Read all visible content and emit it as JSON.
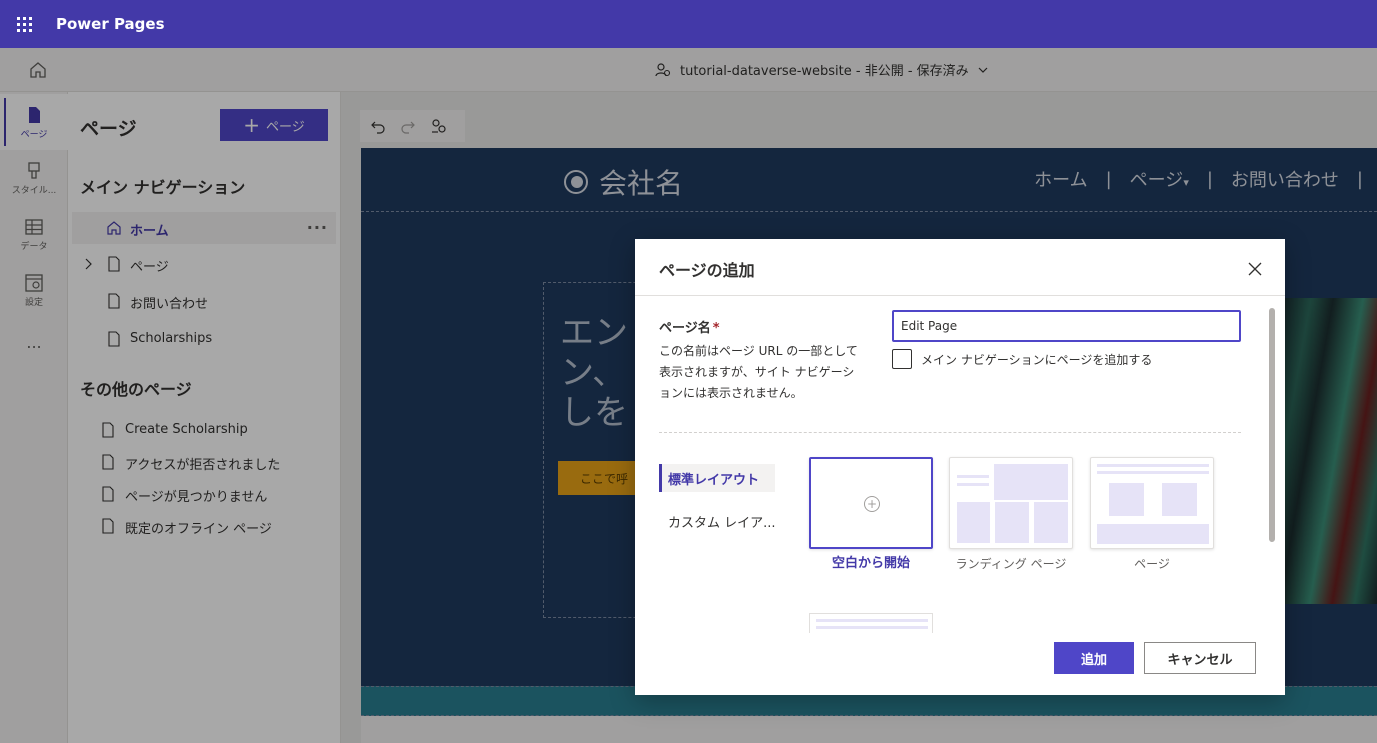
{
  "app": {
    "name": "Power Pages"
  },
  "subbar": {
    "site_info": "tutorial-dataverse-website - 非公開 - 保存済み"
  },
  "rail": {
    "items": [
      {
        "label": "ページ",
        "icon": "page-icon"
      },
      {
        "label": "スタイル...",
        "icon": "brush-icon"
      },
      {
        "label": "データ",
        "icon": "table-icon"
      },
      {
        "label": "設定",
        "icon": "settings-icon"
      },
      {
        "label": "...",
        "icon": "more-icon"
      }
    ]
  },
  "panel": {
    "title": "ページ",
    "add_page_label": "ページ",
    "main_nav_title": "メイン ナビゲーション",
    "main_nav_items": [
      "ホーム",
      "ページ",
      "お問い合わせ",
      "Scholarships"
    ],
    "other_pages_title": "その他のページ",
    "other_pages": [
      "Create Scholarship",
      "アクセスが拒否されました",
      "ページが見つかりません",
      "既定のオフライン ページ"
    ]
  },
  "site": {
    "company_name": "会社名",
    "nav": [
      "ホーム",
      "ページ",
      "お問い合わせ"
    ],
    "nav_separator": "|",
    "hero_text": "エン\nン、\nしを",
    "hero_button": "ここで呼"
  },
  "dialog": {
    "title": "ページの追加",
    "page_name_label": "ページ名",
    "required_mark": "*",
    "page_name_desc": "この名前はページ URL の一部として表示されますが、サイト ナビゲーションには表示されません。",
    "page_name_value": "Edit Page",
    "add_to_nav_label": "メイン ナビゲーションにページを追加する",
    "layout_tabs": [
      "標準レイアウト",
      "カスタム レイア..."
    ],
    "templates": [
      {
        "label": "空白から開始"
      },
      {
        "label": "ランディング ページ"
      },
      {
        "label": "ページ"
      }
    ],
    "add_button": "追加",
    "cancel_button": "キャンセル"
  },
  "colors": {
    "brand": "#4339a8",
    "primary_button": "#4f46c8",
    "site_dark": "#1f3a5e",
    "hero_button": "#e8a317"
  }
}
